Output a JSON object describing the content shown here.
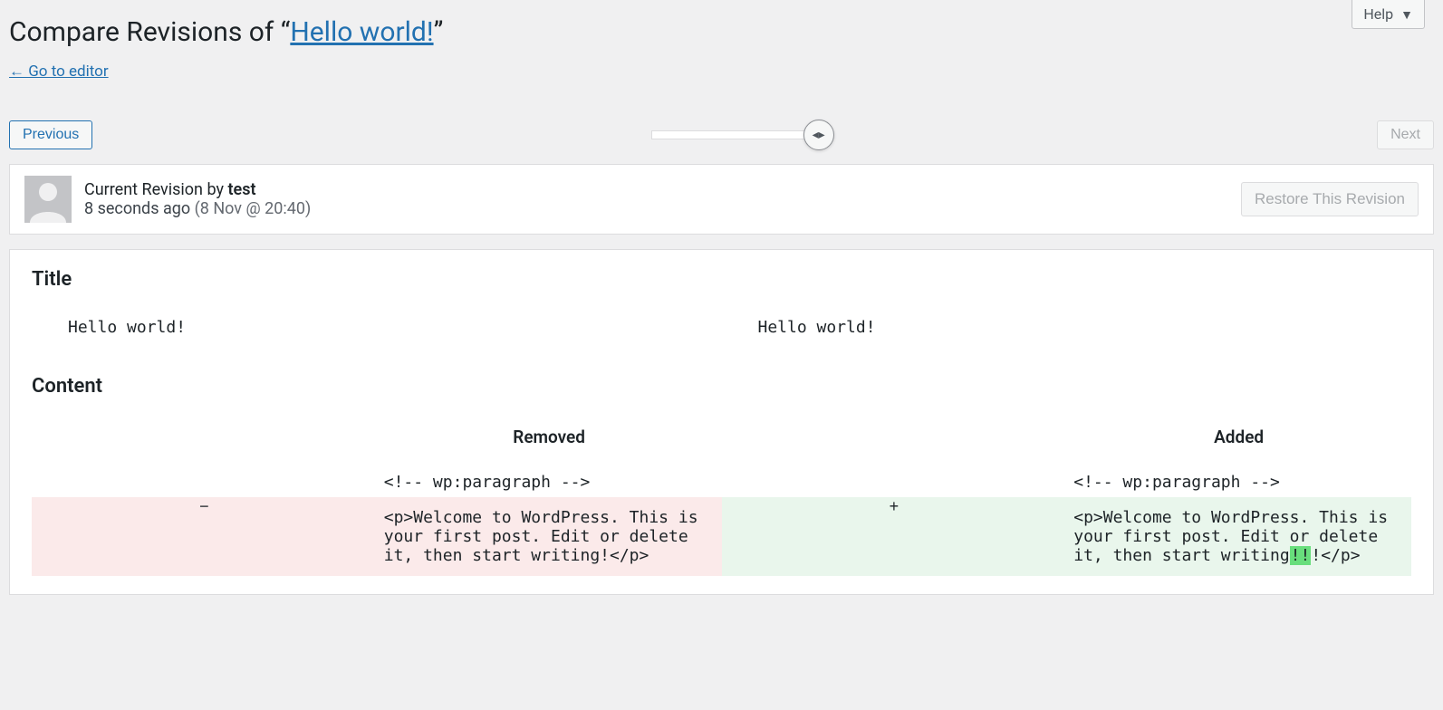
{
  "help": {
    "label": "Help"
  },
  "page": {
    "title_prefix": "Compare Revisions of “",
    "post_title": "Hello world!",
    "title_suffix": "”",
    "go_editor": "← Go to editor"
  },
  "nav": {
    "previous": "Previous",
    "next": "Next"
  },
  "meta": {
    "current_label": "Current Revision by ",
    "author": "test",
    "time_ago": "8 seconds ago",
    "date_detail": "(8 Nov @ 20:40)",
    "restore": "Restore This Revision"
  },
  "diff": {
    "title_section": "Title",
    "title_left": "Hello world!",
    "title_right": "Hello world!",
    "content_section": "Content",
    "removed_header": "Removed",
    "added_header": "Added",
    "context_left": "<!-- wp:paragraph -->",
    "context_right": "<!-- wp:paragraph -->",
    "removed_marker": "−",
    "removed_text": "<p>Welcome to WordPress. This is your first post. Edit or delete it, then start writing!</p>",
    "added_marker": "+",
    "added_prefix": "<p>Welcome to WordPress. This is your first post. Edit or delete it, then start writing",
    "added_ins": "!!",
    "added_suffix": "!</p>"
  }
}
